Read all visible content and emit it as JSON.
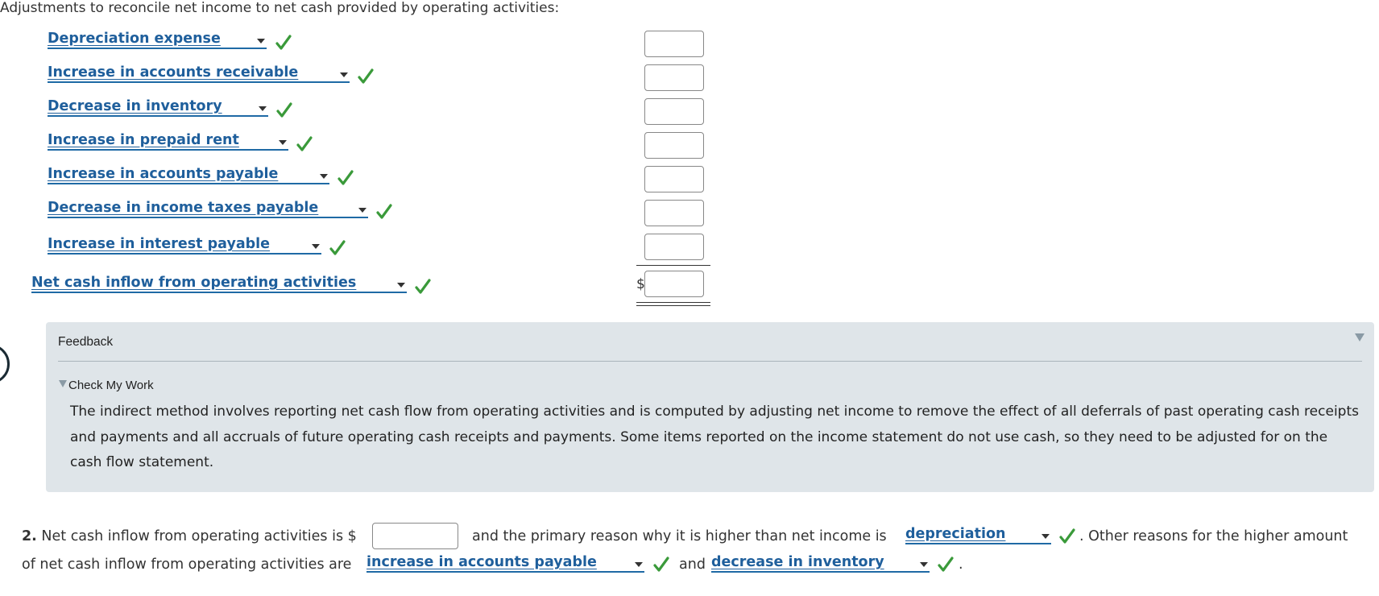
{
  "heading": "Adjustments to reconcile net income to net cash provided by operating activities:",
  "adjustments": [
    {
      "label": "Depreciation expense"
    },
    {
      "label": "Increase in accounts receivable"
    },
    {
      "label": "Decrease in inventory"
    },
    {
      "label": "Increase in prepaid rent"
    },
    {
      "label": "Increase in accounts payable"
    },
    {
      "label": "Decrease in income taxes payable"
    },
    {
      "label": "Increase in interest payable"
    }
  ],
  "net_row": {
    "label": "Net cash inflow from operating activities",
    "currency": "$"
  },
  "feedback": {
    "title": "Feedback",
    "section": "Check My Work",
    "text": "The indirect method involves reporting net cash flow from operating activities and is computed by adjusting net income to remove the effect of all deferrals of past operating cash receipts and payments and all accruals of future operating cash receipts and payments. Some items reported on the income statement do not use cash, so they need to be adjusted for on the cash flow statement."
  },
  "question2": {
    "number": "2.",
    "part1": "Net cash inflow from operating activities is $",
    "part2": "and the primary reason why it is higher than net income is",
    "select1": "depreciation",
    "part3": ". Other reasons for the higher amount",
    "part4": "of net cash inflow from operating activities are",
    "select2": "increase in accounts payable",
    "part5": "and",
    "select3": "decrease in inventory",
    "part6": "."
  },
  "colors": {
    "link": "#1f5f9c",
    "check": "#3a9a3a",
    "panel": "#dfe5e9"
  }
}
